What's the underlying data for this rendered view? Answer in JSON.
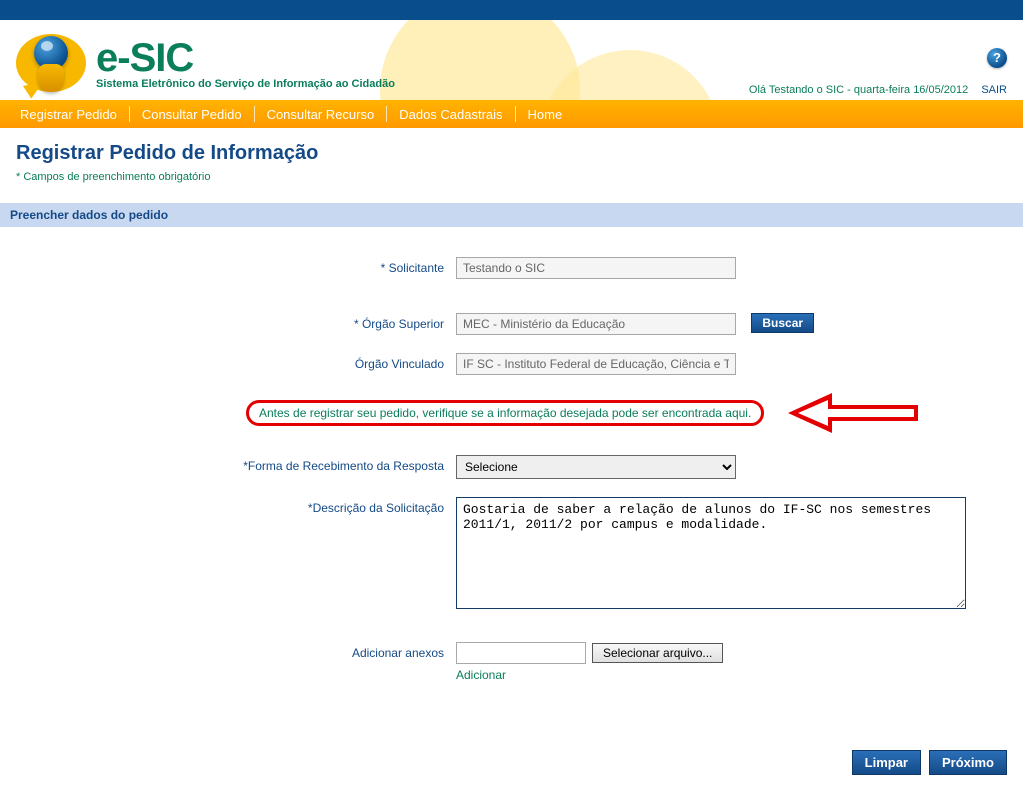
{
  "brand": {
    "title": "e-SIC",
    "subtitle": "Sistema Eletrônico do Serviço de Informação ao Cidadão"
  },
  "header": {
    "greeting": "Olá Testando o SIC - quarta-feira 16/05/2012",
    "logout": "SAIR",
    "help": "?"
  },
  "nav": {
    "items": [
      "Registrar Pedido",
      "Consultar Pedido",
      "Consultar Recurso",
      "Dados Cadastrais",
      "Home"
    ]
  },
  "page": {
    "title": "Registrar Pedido de Informação",
    "required_note": "* Campos de preenchimento obrigatório",
    "section_title": "Preencher dados do pedido"
  },
  "form": {
    "solicitante": {
      "label": "* Solicitante",
      "value": "Testando o SIC"
    },
    "orgao_superior": {
      "label": "* Órgão Superior",
      "value": "MEC - Ministério da Educação",
      "buscar": "Buscar"
    },
    "orgao_vinculado": {
      "label": "Órgão Vinculado",
      "value": "IF SC - Instituto Federal de Educação, Ciência e Te"
    },
    "notice": "Antes de registrar seu pedido, verifique se a informação desejada pode ser encontrada aqui.",
    "forma_recebimento": {
      "label": "*Forma de Recebimento da Resposta",
      "selected": "Selecione"
    },
    "descricao": {
      "label": "*Descrição da Solicitação",
      "value": "Gostaria de saber a relação de alunos do IF-SC nos semestres 2011/1, 2011/2 por campus e modalidade."
    },
    "anexos": {
      "label": "Adicionar anexos",
      "file_button": "Selecionar arquivo...",
      "add_link": "Adicionar"
    }
  },
  "footer": {
    "limpar": "Limpar",
    "proximo": "Próximo"
  }
}
